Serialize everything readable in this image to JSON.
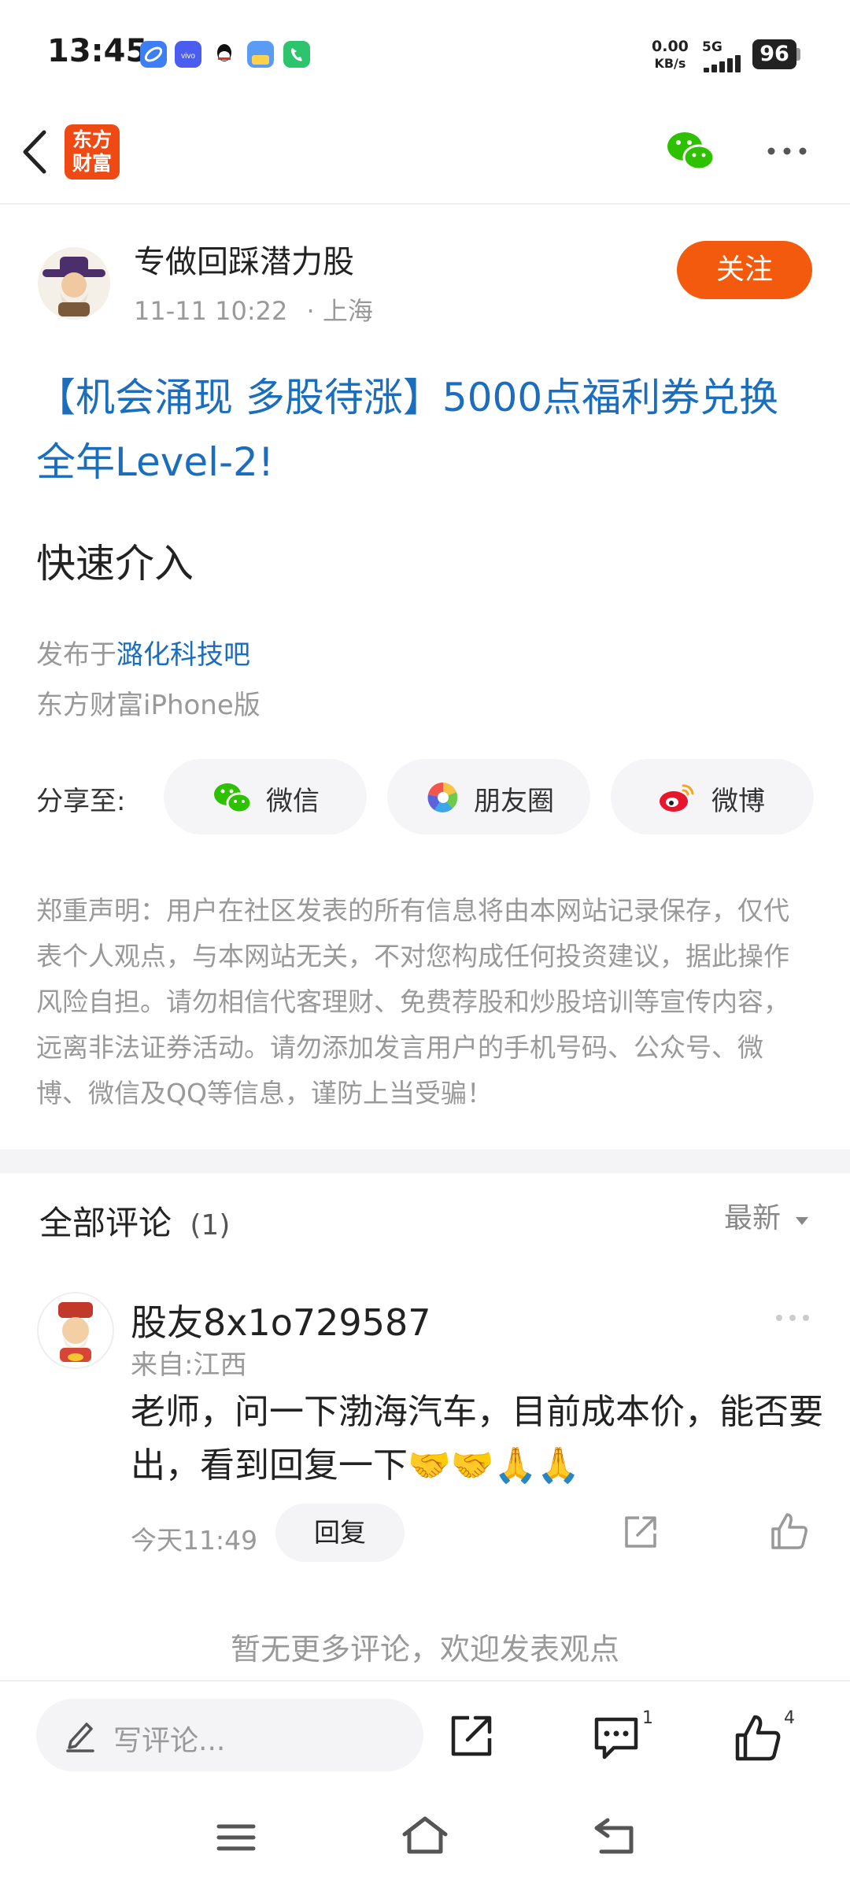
{
  "status_bar": {
    "time": "13:45",
    "net_speed_value": "0.00",
    "net_speed_unit": "KB/s",
    "network": "5G",
    "battery": "96",
    "app_icons": [
      "browser-icon",
      "vivo-icon",
      "qq-icon",
      "file-manager-icon",
      "phone-icon"
    ]
  },
  "nav": {
    "logo_line1": "东方",
    "logo_line2": "财富",
    "wechat_icon": "wechat-icon",
    "more_icon": "more-icon"
  },
  "post": {
    "author": "专做回踩潜力股",
    "date": "11-11 10:22",
    "location": "· 上海",
    "follow_label": "关注",
    "title": "【机会涌现 多股待涨】5000点福利券兑换全年Level-2!",
    "body": "快速介入",
    "published_prefix": "发布于",
    "board": "潞化科技吧",
    "client": "东方财富iPhone版"
  },
  "share": {
    "label": "分享至:",
    "wechat": "微信",
    "moments": "朋友圈",
    "weibo": "微博"
  },
  "disclaimer": "郑重声明：用户在社区发表的所有信息将由本网站记录保存，仅代表个人观点，与本网站无关，不对您构成任何投资建议，据此操作风险自担。请勿相信代客理财、免费荐股和炒股培训等宣传内容，远离非法证券活动。请勿添加发言用户的手机号码、公众号、微博、微信及QQ等信息，谨防上当受骗！",
  "comments": {
    "title": "全部评论",
    "count": "(1)",
    "sort_label": "最新",
    "items": [
      {
        "user": "股友8x1o729587",
        "location": "来自:江西",
        "text": "老师，问一下渤海汽车，目前成本价，能否要出，看到回复一下🤝🤝🙏🙏",
        "time": "今天11:49",
        "reply_label": "回复"
      }
    ],
    "no_more": "暂无更多评论，欢迎发表观点"
  },
  "bottom_bar": {
    "input_placeholder": "写评论...",
    "comment_badge": "1",
    "like_badge": "4"
  },
  "colors": {
    "accent_orange": "#f35a0d",
    "link_blue": "#1b6dbd",
    "wechat_green": "#2dc100"
  }
}
